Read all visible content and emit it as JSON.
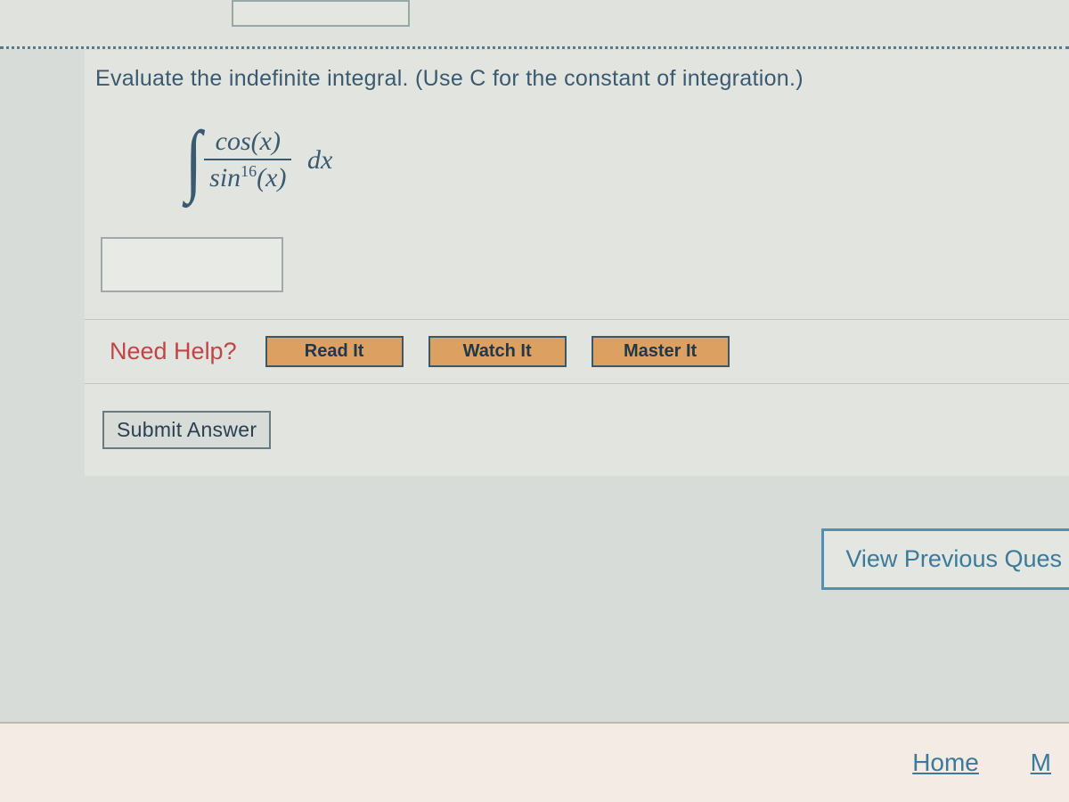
{
  "question": {
    "prompt": "Evaluate the indefinite integral. (Use C for the constant of integration.)",
    "integral_numerator": "cos(x)",
    "integral_denominator_base": "sin",
    "integral_denominator_exp": "16",
    "integral_denominator_arg": "(x)",
    "differential": "dx"
  },
  "help": {
    "label": "Need Help?",
    "read": "Read It",
    "watch": "Watch It",
    "master": "Master It"
  },
  "submit": {
    "label": "Submit Answer"
  },
  "nav": {
    "view_previous": "View Previous Ques",
    "home": "Home",
    "m": "M"
  }
}
